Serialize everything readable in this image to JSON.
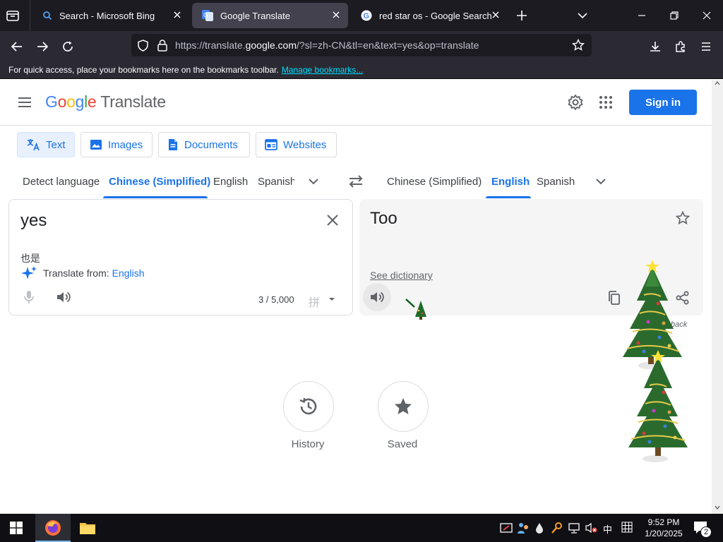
{
  "browser": {
    "tabs": [
      {
        "title": "Search - Microsoft Bing",
        "icon": "search-icon"
      },
      {
        "title": "Google Translate",
        "icon": "google-translate-icon"
      },
      {
        "title": "red star os - Google Search",
        "icon": "google-icon"
      }
    ],
    "url": {
      "prefix": "https://translate.",
      "domain": "google.com",
      "path": "/?sl=zh-CN&tl=en&text=yes&op=translate"
    },
    "bookmarks_bar": {
      "text": "For quick access, place your bookmarks here on the bookmarks toolbar.",
      "link": "Manage bookmarks..."
    }
  },
  "header": {
    "logo_letters": [
      "G",
      "o",
      "o",
      "g",
      "l",
      "e"
    ],
    "product": "Translate",
    "signin": "Sign in"
  },
  "modes": [
    {
      "label": "Text"
    },
    {
      "label": "Images"
    },
    {
      "label": "Documents"
    },
    {
      "label": "Websites"
    }
  ],
  "source_langs": [
    "Detect language",
    "Chinese (Simplified)",
    "English",
    "Spanish"
  ],
  "target_langs": [
    "Chinese (Simplified)",
    "English",
    "Spanish"
  ],
  "source": {
    "text": "yes",
    "romanization": "也是",
    "translate_from_label": "Translate from:",
    "translate_from_lang": "English",
    "count": "3 / 5,000",
    "input_tool_glyph": "拼"
  },
  "target": {
    "text": "Too",
    "see_dictionary": "See dictionary",
    "feedback": "back"
  },
  "bottom": {
    "history": "History",
    "saved": "Saved"
  },
  "taskbar": {
    "time": "9:52 PM",
    "date": "1/20/2025",
    "ime": "中",
    "notifications": "2"
  },
  "colors": {
    "accent": "#1a73e8",
    "firefox_tabbar": "#1c1b22",
    "firefox_toolbar": "#2b2a33"
  }
}
